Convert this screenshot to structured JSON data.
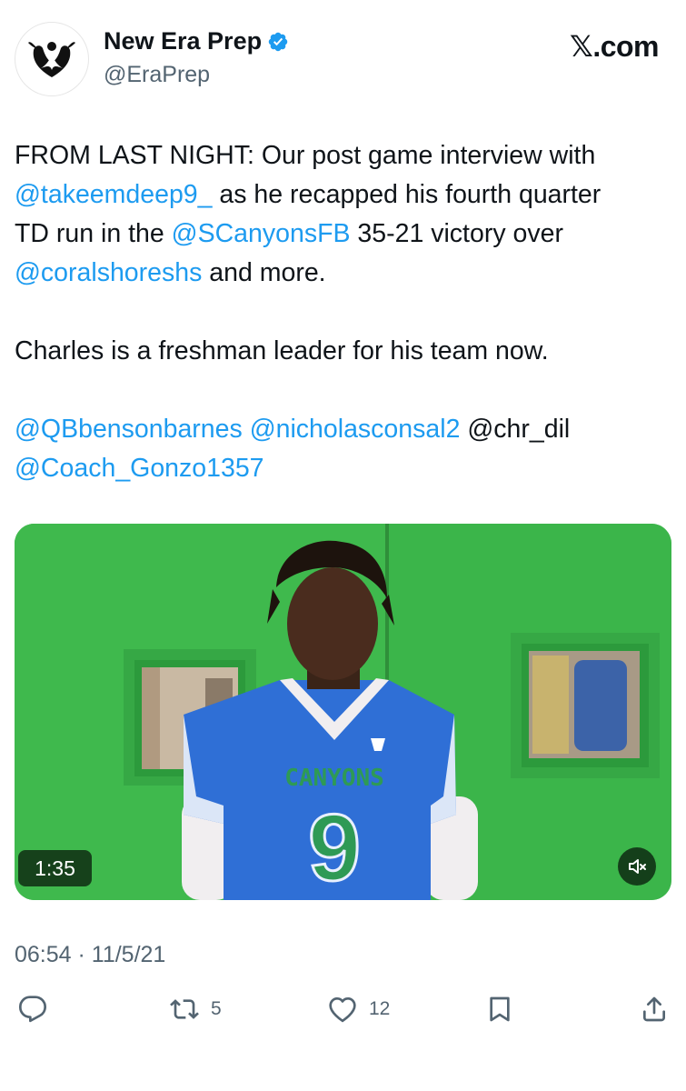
{
  "account": {
    "display_name": "New Era Prep",
    "handle": "@EraPrep",
    "verified": true
  },
  "brand": {
    "site": "X.com",
    "x_glyph": "𝕏",
    "site_suffix": ".com"
  },
  "tweet": {
    "line1_text": "FROM LAST NIGHT: Our post game interview with",
    "mention_takeem": "@takeemdeep9_",
    "line2_text": " as he recapped his fourth quarter",
    "line3_text": "TD run in the ",
    "mention_scanyons": "@SCanyonsFB",
    "line3_rest": " 35-21 victory over",
    "mention_coral": "@coralshoreshs",
    "line4_rest": " and more.",
    "paragraph2": "Charles is a freshman leader for his team now.",
    "mention_qb": "@QBbensonbarnes",
    "mention_nicholas": "@nicholasconsal2",
    "mention_chr": "@chr_dil",
    "mention_coach": "@Coach_Gonzo1357"
  },
  "media": {
    "duration": "1:35",
    "jersey_text": "CANYONS",
    "jersey_number": "9",
    "colors": {
      "background_green": "#3bb54a",
      "jersey_blue": "#2f6fd6",
      "jersey_green": "#2e9a55"
    }
  },
  "timestamp": "06:54 · 11/5/21",
  "actions": {
    "reply_count": "",
    "retweet_count": "5",
    "like_count": "12"
  },
  "colors": {
    "link": "#1d9bf0",
    "secondary_text": "#536471",
    "verified": "#1d9bf0"
  },
  "icons": [
    "reply-icon",
    "retweet-icon",
    "like-icon",
    "bookmark-icon",
    "share-icon",
    "mute-icon",
    "verified-badge-icon"
  ]
}
